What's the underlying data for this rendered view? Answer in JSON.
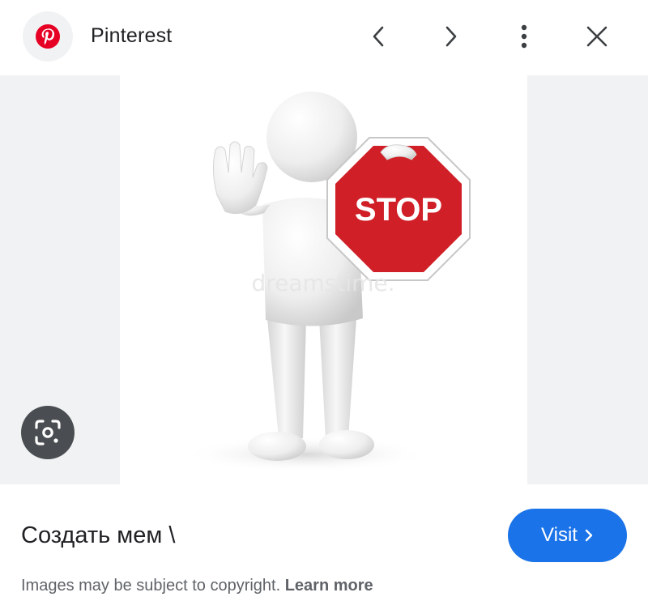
{
  "header": {
    "source_name": "Pinterest",
    "logo_icon": "pinterest-logo-icon",
    "brand_color": "#e60023",
    "prev_icon": "chevron-left-icon",
    "next_icon": "chevron-right-icon",
    "more_icon": "more-vert-icon",
    "close_icon": "close-icon"
  },
  "image": {
    "sign_text": "STOP",
    "watermark": "dreamstime.",
    "lens_icon": "google-lens-icon"
  },
  "result": {
    "title": "Создать мем \\",
    "visit_label": "Visit",
    "visit_color": "#1a73e8"
  },
  "footer": {
    "copyright_text": "Images may be subject to copyright. ",
    "learn_more_label": "Learn more"
  }
}
